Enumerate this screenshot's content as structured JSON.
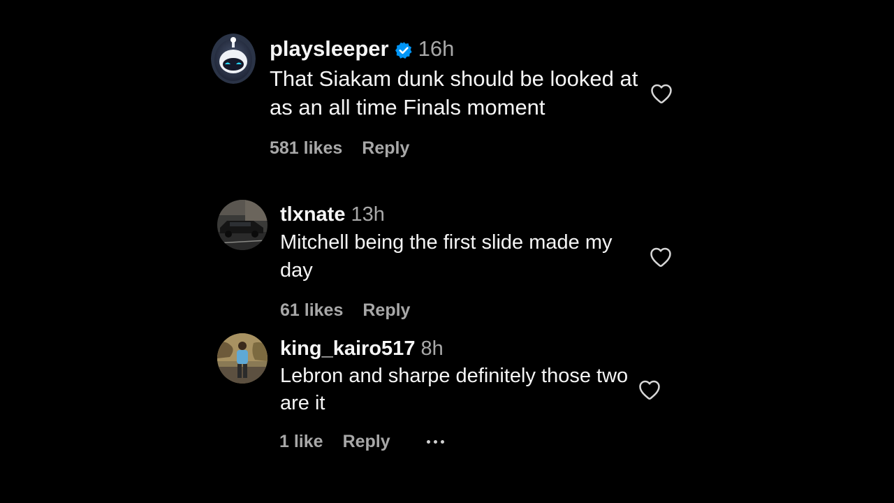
{
  "comments": [
    {
      "username": "playsleeper",
      "verified": true,
      "time": "16h",
      "text": "That Siakam dunk should be looked at as an all time Finals moment",
      "likes": "581 likes",
      "reply_label": "Reply"
    },
    {
      "username": "tlxnate",
      "verified": false,
      "time": "13h",
      "text": "Mitchell being the first slide made my day",
      "likes": "61 likes",
      "reply_label": "Reply"
    },
    {
      "username": "king_kairo517",
      "verified": false,
      "time": "8h",
      "text": "Lebron and sharpe definitely those two are it",
      "likes": "1 like",
      "reply_label": "Reply"
    }
  ],
  "icons": {
    "verified": "verified-badge-icon",
    "like": "heart-icon",
    "more": "more-options-icon"
  },
  "colors": {
    "background": "#000000",
    "text": "#f5f5f5",
    "secondary": "#a8a8a8",
    "verified_blue": "#0095f6"
  }
}
